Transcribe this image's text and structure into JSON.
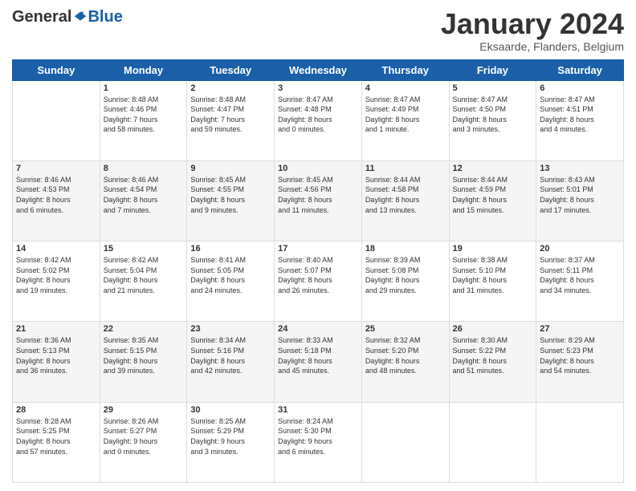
{
  "logo": {
    "general": "General",
    "blue": "Blue"
  },
  "header": {
    "title": "January 2024",
    "subtitle": "Eksaarde, Flanders, Belgium"
  },
  "days_of_week": [
    "Sunday",
    "Monday",
    "Tuesday",
    "Wednesday",
    "Thursday",
    "Friday",
    "Saturday"
  ],
  "weeks": [
    [
      {
        "day": "",
        "info": ""
      },
      {
        "day": "1",
        "info": "Sunrise: 8:48 AM\nSunset: 4:46 PM\nDaylight: 7 hours\nand 58 minutes."
      },
      {
        "day": "2",
        "info": "Sunrise: 8:48 AM\nSunset: 4:47 PM\nDaylight: 7 hours\nand 59 minutes."
      },
      {
        "day": "3",
        "info": "Sunrise: 8:47 AM\nSunset: 4:48 PM\nDaylight: 8 hours\nand 0 minutes."
      },
      {
        "day": "4",
        "info": "Sunrise: 8:47 AM\nSunset: 4:49 PM\nDaylight: 8 hours\nand 1 minute."
      },
      {
        "day": "5",
        "info": "Sunrise: 8:47 AM\nSunset: 4:50 PM\nDaylight: 8 hours\nand 3 minutes."
      },
      {
        "day": "6",
        "info": "Sunrise: 8:47 AM\nSunset: 4:51 PM\nDaylight: 8 hours\nand 4 minutes."
      }
    ],
    [
      {
        "day": "7",
        "info": "Sunrise: 8:46 AM\nSunset: 4:53 PM\nDaylight: 8 hours\nand 6 minutes."
      },
      {
        "day": "8",
        "info": "Sunrise: 8:46 AM\nSunset: 4:54 PM\nDaylight: 8 hours\nand 7 minutes."
      },
      {
        "day": "9",
        "info": "Sunrise: 8:45 AM\nSunset: 4:55 PM\nDaylight: 8 hours\nand 9 minutes."
      },
      {
        "day": "10",
        "info": "Sunrise: 8:45 AM\nSunset: 4:56 PM\nDaylight: 8 hours\nand 11 minutes."
      },
      {
        "day": "11",
        "info": "Sunrise: 8:44 AM\nSunset: 4:58 PM\nDaylight: 8 hours\nand 13 minutes."
      },
      {
        "day": "12",
        "info": "Sunrise: 8:44 AM\nSunset: 4:59 PM\nDaylight: 8 hours\nand 15 minutes."
      },
      {
        "day": "13",
        "info": "Sunrise: 8:43 AM\nSunset: 5:01 PM\nDaylight: 8 hours\nand 17 minutes."
      }
    ],
    [
      {
        "day": "14",
        "info": "Sunrise: 8:42 AM\nSunset: 5:02 PM\nDaylight: 8 hours\nand 19 minutes."
      },
      {
        "day": "15",
        "info": "Sunrise: 8:42 AM\nSunset: 5:04 PM\nDaylight: 8 hours\nand 21 minutes."
      },
      {
        "day": "16",
        "info": "Sunrise: 8:41 AM\nSunset: 5:05 PM\nDaylight: 8 hours\nand 24 minutes."
      },
      {
        "day": "17",
        "info": "Sunrise: 8:40 AM\nSunset: 5:07 PM\nDaylight: 8 hours\nand 26 minutes."
      },
      {
        "day": "18",
        "info": "Sunrise: 8:39 AM\nSunset: 5:08 PM\nDaylight: 8 hours\nand 29 minutes."
      },
      {
        "day": "19",
        "info": "Sunrise: 8:38 AM\nSunset: 5:10 PM\nDaylight: 8 hours\nand 31 minutes."
      },
      {
        "day": "20",
        "info": "Sunrise: 8:37 AM\nSunset: 5:11 PM\nDaylight: 8 hours\nand 34 minutes."
      }
    ],
    [
      {
        "day": "21",
        "info": "Sunrise: 8:36 AM\nSunset: 5:13 PM\nDaylight: 8 hours\nand 36 minutes."
      },
      {
        "day": "22",
        "info": "Sunrise: 8:35 AM\nSunset: 5:15 PM\nDaylight: 8 hours\nand 39 minutes."
      },
      {
        "day": "23",
        "info": "Sunrise: 8:34 AM\nSunset: 5:16 PM\nDaylight: 8 hours\nand 42 minutes."
      },
      {
        "day": "24",
        "info": "Sunrise: 8:33 AM\nSunset: 5:18 PM\nDaylight: 8 hours\nand 45 minutes."
      },
      {
        "day": "25",
        "info": "Sunrise: 8:32 AM\nSunset: 5:20 PM\nDaylight: 8 hours\nand 48 minutes."
      },
      {
        "day": "26",
        "info": "Sunrise: 8:30 AM\nSunset: 5:22 PM\nDaylight: 8 hours\nand 51 minutes."
      },
      {
        "day": "27",
        "info": "Sunrise: 8:29 AM\nSunset: 5:23 PM\nDaylight: 8 hours\nand 54 minutes."
      }
    ],
    [
      {
        "day": "28",
        "info": "Sunrise: 8:28 AM\nSunset: 5:25 PM\nDaylight: 8 hours\nand 57 minutes."
      },
      {
        "day": "29",
        "info": "Sunrise: 8:26 AM\nSunset: 5:27 PM\nDaylight: 9 hours\nand 0 minutes."
      },
      {
        "day": "30",
        "info": "Sunrise: 8:25 AM\nSunset: 5:29 PM\nDaylight: 9 hours\nand 3 minutes."
      },
      {
        "day": "31",
        "info": "Sunrise: 8:24 AM\nSunset: 5:30 PM\nDaylight: 9 hours\nand 6 minutes."
      },
      {
        "day": "",
        "info": ""
      },
      {
        "day": "",
        "info": ""
      },
      {
        "day": "",
        "info": ""
      }
    ]
  ]
}
